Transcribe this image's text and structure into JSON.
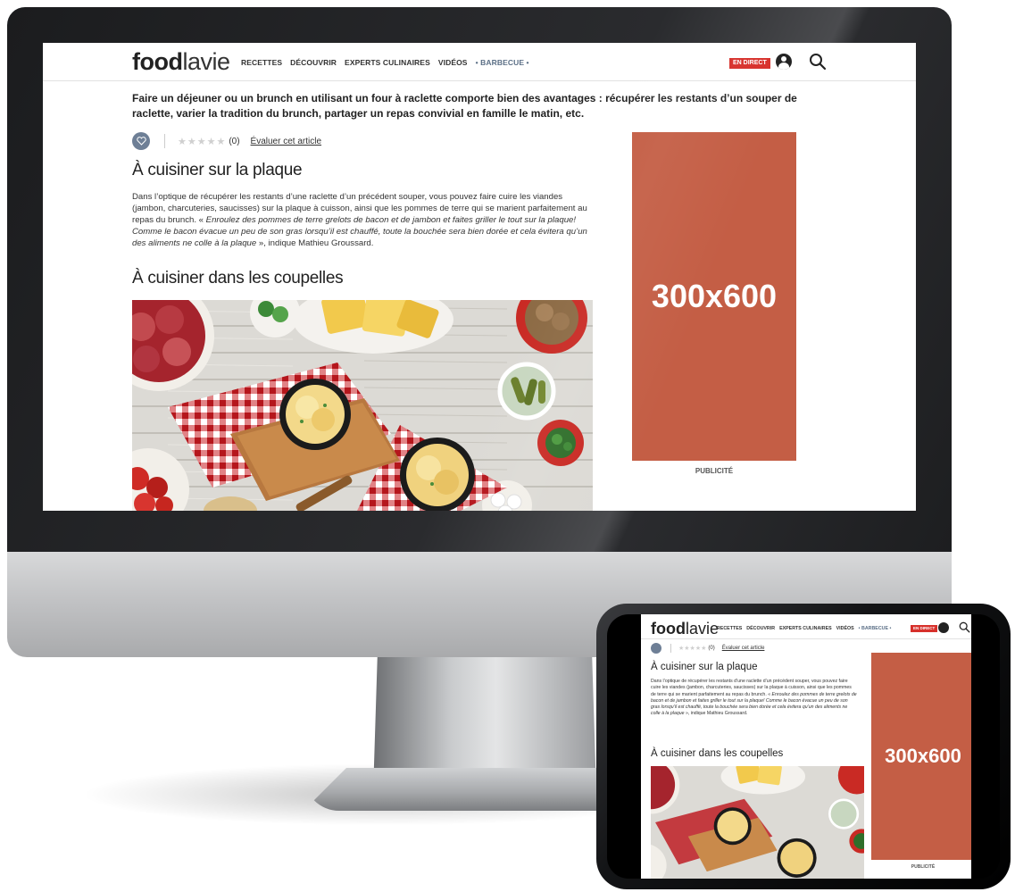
{
  "site": {
    "logo_bold": "food",
    "logo_light": "lavie",
    "nav": [
      "RECETTES",
      "DÉCOUVRIR",
      "EXPERTS CULINAIRES",
      "VIDÉOS",
      "• BARBECUE •"
    ],
    "live_label": "EN DIRECT"
  },
  "article": {
    "intro": "Faire un déjeuner ou un brunch en utilisant un four à raclette comporte bien des avantages : récupérer les restants d’un souper de raclette, varier la tradition du brunch, partager un repas convivial en famille le matin, etc.",
    "stars": "★★★★★",
    "rating_count": "(0)",
    "rate_link": "Évaluer cet article",
    "section1_title": "À cuisiner sur la plaque",
    "section1_text_plain": "Dans l’optique de récupérer les restants d’une raclette d’un précédent souper, vous pouvez faire cuire les viandes (jambon, charcuteries, saucisses) sur la plaque à cuisson, ainsi que les pommes de terre qui se marient parfaitement au repas du brunch. « ",
    "section1_text_quote": "Enroulez des pommes de terre grelots de bacon et de jambon et faites griller le tout sur la plaque! Comme le bacon évacue un peu de son gras lorsqu’il est chauffé, toute la bouchée sera bien dorée et cela évitera qu’un des aliments ne colle à la plaque",
    "section1_text_end": " », indique Mathieu Groussard.",
    "section2_title": "À cuisiner dans les coupelles"
  },
  "ad": {
    "size_label": "300x600",
    "caption": "PUBLICITÉ",
    "color": "#c45e45"
  },
  "icons": {
    "heart": "heart-icon",
    "user": "user-icon",
    "search": "search-icon"
  }
}
